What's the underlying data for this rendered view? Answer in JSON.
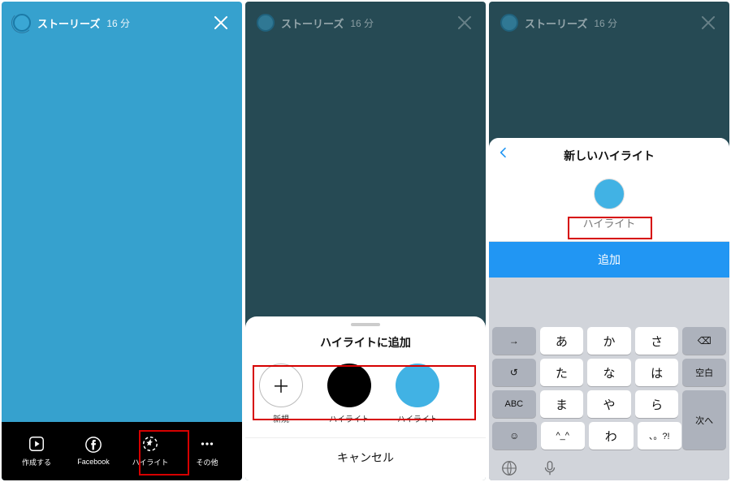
{
  "header": {
    "title": "ストーリーズ",
    "time": "16 分"
  },
  "screen1": {
    "bottom": {
      "create": "作成する",
      "facebook": "Facebook",
      "highlight": "ハイライト",
      "more": "その他"
    }
  },
  "screen2": {
    "sheetTitle": "ハイライトに追加",
    "items": {
      "new": "新規",
      "h1": "ハイライト",
      "h2": "ハイライト"
    },
    "cancel": "キャンセル"
  },
  "screen3": {
    "title": "新しいハイライト",
    "placeholder": "ハイライト",
    "addBtn": "追加",
    "keys": {
      "r1": [
        "あ",
        "か",
        "さ"
      ],
      "r2": [
        "た",
        "な",
        "は"
      ],
      "r3": [
        "ま",
        "や",
        "ら"
      ],
      "r4": [
        "^_^",
        "わ",
        "、。?!"
      ],
      "arrow": "→",
      "undo": "↺",
      "abc": "ABC",
      "emoji": "☺",
      "del": "⌫",
      "space": "空白",
      "next": "次へ"
    }
  }
}
